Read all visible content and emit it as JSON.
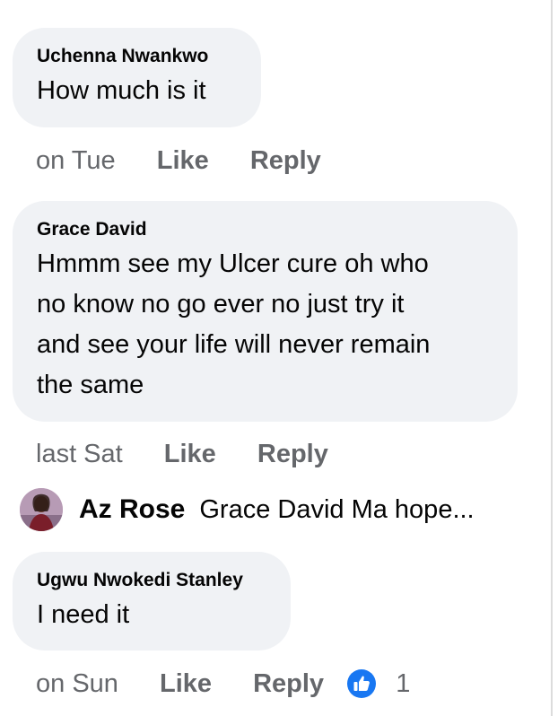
{
  "comments": [
    {
      "author": "Uchenna Nwankwo",
      "text_lines": [
        "How much is it"
      ],
      "time": "on Tue",
      "like_label": "Like",
      "reply_label": "Reply"
    },
    {
      "author": "Grace David",
      "text_lines": [
        "Hmmm see my Ulcer cure oh who",
        "no know no go ever no just try it",
        "and see your life will never remain",
        "the same"
      ],
      "time": "last Sat",
      "like_label": "Like",
      "reply_label": "Reply"
    },
    {
      "author": "Ugwu Nwokedi Stanley",
      "text_lines": [
        "I need it"
      ],
      "time": "on Sun",
      "like_label": "Like",
      "reply_label": "Reply",
      "reaction_icon": "like-icon",
      "reaction_count": "1"
    }
  ],
  "reply_preview": {
    "author": "Az Rose",
    "text": "Grace David Ma hope...",
    "avatar_icon": "user-avatar"
  },
  "colors": {
    "bubble": "#f0f2f5",
    "secondary_text": "#65676b",
    "like_blue": "#1877f2"
  }
}
